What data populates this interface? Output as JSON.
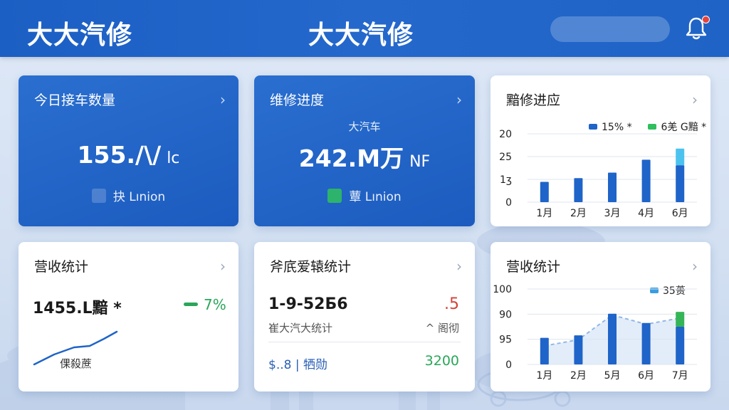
{
  "header": {
    "brand_left": "大大汽修",
    "brand_center": "大大汽修",
    "notification_icon": "bell-icon"
  },
  "cards": {
    "today_cars": {
      "title": "今日接车数量",
      "value": "155./\\/",
      "unit": "lc",
      "badge_icon": "wrench-icon",
      "badge_label": "抉 Lınion"
    },
    "repair_progress": {
      "title": "维修进度",
      "sub_label": "大汽车",
      "value": "242.M万",
      "unit": "NF",
      "badge_icon": "clipboard-icon",
      "badge_label": "蕈 Lınion"
    },
    "progress_chart": {
      "title": "黯修进应",
      "legend": [
        {
          "label": "15% *",
          "color": "#1f64c8"
        },
        {
          "label": "6羌 G黯 *",
          "color": "#2fbf5d"
        }
      ]
    },
    "revenue": {
      "title": "营收统计",
      "value": "1455.L黯 *",
      "pct": "7%",
      "sparkline_label": "倮殺蔗"
    },
    "detail_stats": {
      "title": "斧㡳爱辕统计",
      "value": "1-9-52Б6",
      "value_right": ".5",
      "row1_label": "崔大汽大统计",
      "row1_right": "^ 阁彻",
      "row2_left": "$..8 | 牺勋",
      "row2_right": "3200"
    },
    "revenue_chart": {
      "title": "营收统计",
      "legend": [
        {
          "label": "35蒉",
          "color": "#3a9de0"
        }
      ]
    }
  },
  "chart_data": [
    {
      "type": "bar",
      "title": "黯修进应",
      "categories": [
        "1月",
        "2月",
        "3月",
        "4月",
        "6月"
      ],
      "y_ticks": [
        "0",
        "1ʒ",
        "25",
        "20"
      ],
      "series": [
        {
          "name": "15% *",
          "values": [
            11,
            13,
            16,
            23,
            20
          ],
          "color": "#1f64c8"
        },
        {
          "name": "6羌 G黯 *",
          "values": [
            0,
            0,
            0,
            0,
            9
          ],
          "color": "#4cc3ef"
        }
      ],
      "ylim": [
        0,
        37
      ]
    },
    {
      "type": "bar",
      "title": "营收统计",
      "categories": [
        "1月",
        "2月",
        "5月",
        "6月",
        "7月"
      ],
      "y_ticks": [
        "0",
        "95",
        "90",
        "100"
      ],
      "series": [
        {
          "name": "35蒉",
          "values": [
            43,
            47,
            82,
            67,
            61
          ],
          "color": "#1f64c8"
        },
        {
          "name": "",
          "values": [
            0,
            0,
            0,
            0,
            24
          ],
          "color": "#35b558"
        }
      ],
      "area": [
        30,
        40,
        80,
        65,
        75
      ],
      "ylim": [
        0,
        122
      ]
    }
  ]
}
